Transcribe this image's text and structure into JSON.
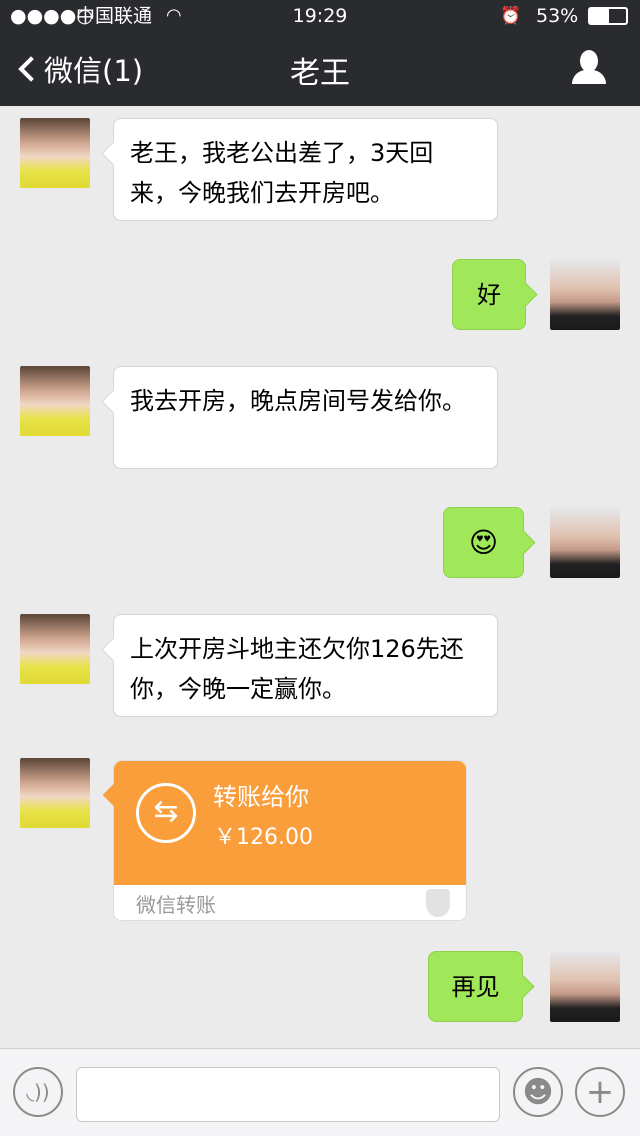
{
  "status_bar": {
    "signal": "●●●●○",
    "carrier": "中国联通",
    "time": "19:29",
    "battery": "53%",
    "battery_level": 0.53
  },
  "nav": {
    "back_label": "微信(1)",
    "title": "老王"
  },
  "messages": [
    {
      "side": "left",
      "text": "老王，我老公出差了，3天回来，今晚我们去开房吧。"
    },
    {
      "side": "right",
      "text": "好"
    },
    {
      "side": "left",
      "text": "我去开房，晚点房间号发给你。"
    },
    {
      "side": "right",
      "text": "😍"
    },
    {
      "side": "left",
      "text": "上次开房斗地主还欠你126先还你，今晚一定赢你。"
    },
    {
      "side": "left",
      "type": "transfer",
      "title": "转账给你",
      "amount": "￥126.00",
      "footer": "微信转账"
    },
    {
      "side": "right",
      "text": "再见"
    }
  ],
  "colors": {
    "nav": "#2a2b2f",
    "bubble_right": "#a0e75a",
    "transfer": "#fa9d3b",
    "background": "#ebebeb"
  },
  "input": {
    "value": ""
  }
}
